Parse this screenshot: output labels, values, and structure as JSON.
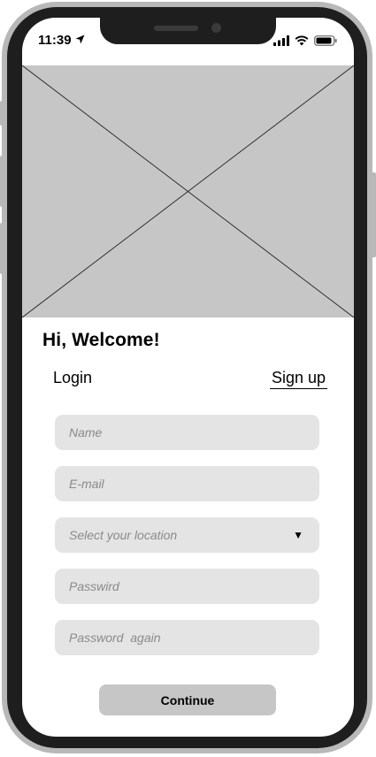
{
  "status_bar": {
    "time": "11:39",
    "icons": [
      "location-arrow-icon",
      "cellular-signal-icon",
      "wifi-icon",
      "battery-icon"
    ]
  },
  "hero": {
    "image": "image-placeholder"
  },
  "welcome": {
    "title": "Hi, Welcome!"
  },
  "tabs": {
    "login": "Login",
    "signup": "Sign up",
    "active": "signup"
  },
  "form": {
    "name": {
      "value": "",
      "placeholder": "Name"
    },
    "email": {
      "value": "",
      "placeholder": "E-mail"
    },
    "location": {
      "value": "Select your location",
      "icon": "triangle-down-icon"
    },
    "password": {
      "value": "",
      "placeholder": "Passwird"
    },
    "password_again": {
      "value": "",
      "placeholder": "Password  again"
    }
  },
  "actions": {
    "continue_label": "Continue"
  },
  "colors": {
    "frame": "#b8b8b8",
    "bezel": "#1e1e1e",
    "placeholder_fill": "#c6c6c6",
    "input_fill": "#e4e4e4",
    "button_fill": "#c6c6c6"
  }
}
